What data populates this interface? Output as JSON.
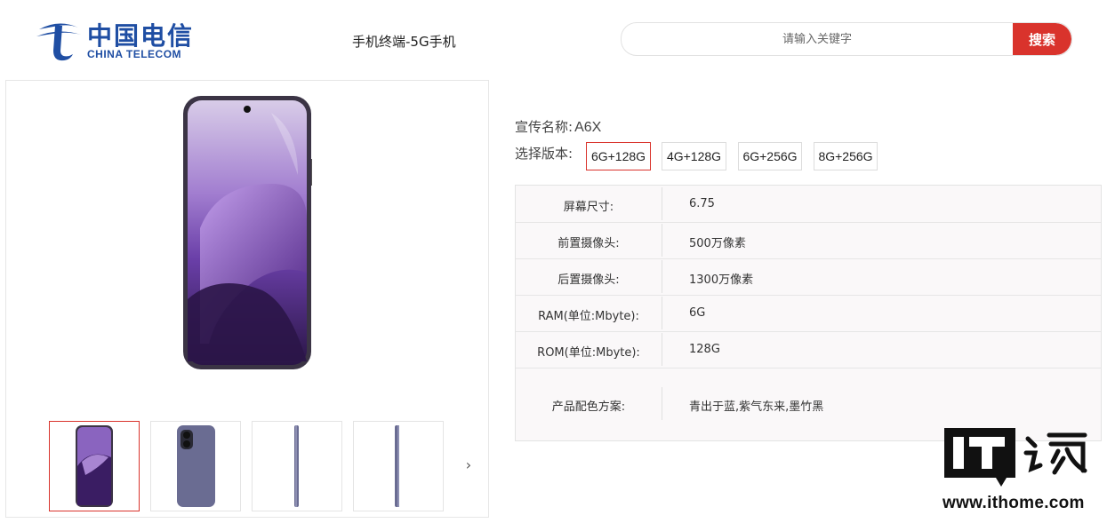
{
  "brand": {
    "name_cn": "中国电信",
    "name_en": "CHINA TELECOM",
    "color": "#1f4ea3"
  },
  "header": {
    "title": "手机终端-5G手机"
  },
  "search": {
    "placeholder": "请输入关键字",
    "value": "",
    "button_label": "搜索",
    "button_color": "#d9332c"
  },
  "gallery": {
    "main_image_desc": "purple-phone-front",
    "thumbnails": [
      {
        "icon": "phone-front-thumb",
        "selected": true
      },
      {
        "icon": "phone-back-thumb",
        "selected": false
      },
      {
        "icon": "phone-side-thumb",
        "selected": false
      },
      {
        "icon": "phone-side-thumb",
        "selected": false
      }
    ],
    "next_icon": "chevron-right-icon",
    "next_glyph": "›"
  },
  "product": {
    "name_label": "宣传名称:",
    "name_value": "A6X",
    "version_label": "选择版本:",
    "versions": [
      "6G+128G",
      "4G+128G",
      "6G+256G",
      "8G+256G"
    ],
    "selected_version": "6G+128G"
  },
  "specs": [
    {
      "key": "屏幕尺寸:",
      "value": "6.75"
    },
    {
      "key": "前置摄像头:",
      "value": "500万像素"
    },
    {
      "key": "后置摄像头:",
      "value": "1300万像素"
    },
    {
      "key": "RAM(单位:Mbyte):",
      "value": "6G"
    },
    {
      "key": "ROM(单位:Mbyte):",
      "value": "128G"
    },
    {
      "key": "产品配色方案:",
      "value": "青出于蓝,紫气东来,墨竹黑"
    }
  ],
  "watermark": {
    "logo_text": "IT之家",
    "site": "www.ithome.com"
  }
}
